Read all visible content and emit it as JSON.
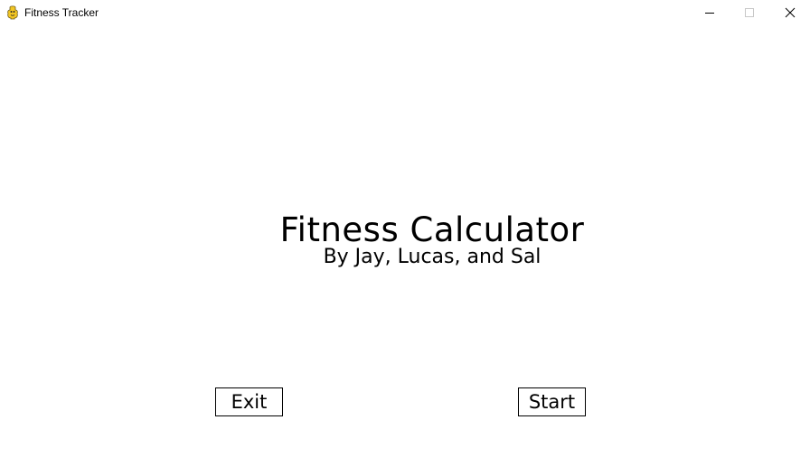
{
  "window": {
    "title": "Fitness Tracker",
    "app_icon": "pygame-snake-icon",
    "controls": {
      "minimize_icon": "minimize-icon",
      "maximize_icon": "maximize-icon",
      "close_icon": "close-icon"
    }
  },
  "main": {
    "title": "Fitness Calculator",
    "subtitle": "By Jay, Lucas, and Sal"
  },
  "buttons": {
    "exit_label": "Exit",
    "start_label": "Start"
  },
  "colors": {
    "background": "#ffffff",
    "text": "#000000",
    "button_border": "#000000"
  }
}
